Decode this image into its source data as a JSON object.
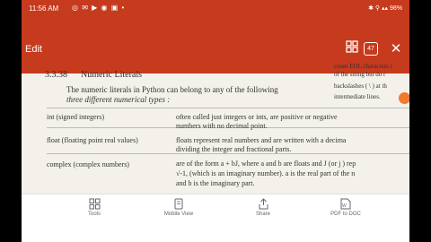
{
  "status_bar": {
    "time": "11:56 AM",
    "left_icons": "◎ ✉ ▶ ◉ ▣ •",
    "right": "✱ ⚲ ▴▴ 98%"
  },
  "toolbar": {
    "title": "Edit",
    "grid_icon": "grid-icon",
    "page_count": "47",
    "close_icon": "close-icon"
  },
  "document": {
    "section_number": "3.3.38",
    "section_title": "Numeric Literals",
    "intro_line1": "The numeric literals in Python can belong to any of the following",
    "intro_line2": "three different numerical types :",
    "side_notes": [
      "count EOL characters i",
      "of the string but do r",
      "backslashes ( \\ ) at th",
      "intermediate lines."
    ],
    "rows": [
      {
        "label": "int (signed integers)",
        "desc": [
          "often called just integers or ints, are positive or negative",
          "numbers with no decimal point."
        ]
      },
      {
        "label": "float (floating point real values)",
        "desc": [
          "floats represent real numbers and are written with a decima",
          "dividing the integer and fractional parts."
        ]
      },
      {
        "label": "complex (complex numbers)",
        "desc": [
          "are of the form a + bJ, where a and b are floats and J (or j ) rep",
          "√-1, (which is an imaginary number). a is the real part of the n",
          "and b is the imaginary part."
        ]
      }
    ]
  },
  "bottom_bar": {
    "items": [
      {
        "label": "Tools",
        "icon": "tools-icon"
      },
      {
        "label": "Mobile View",
        "icon": "mobile-view-icon"
      },
      {
        "label": "Share",
        "icon": "share-icon"
      },
      {
        "label": "PDF to DOC",
        "icon": "pdf-to-doc-icon"
      }
    ]
  },
  "colors": {
    "accent": "#c63a1e",
    "page": "#f3f1ea",
    "highlight_dot": "#f07a2d"
  }
}
